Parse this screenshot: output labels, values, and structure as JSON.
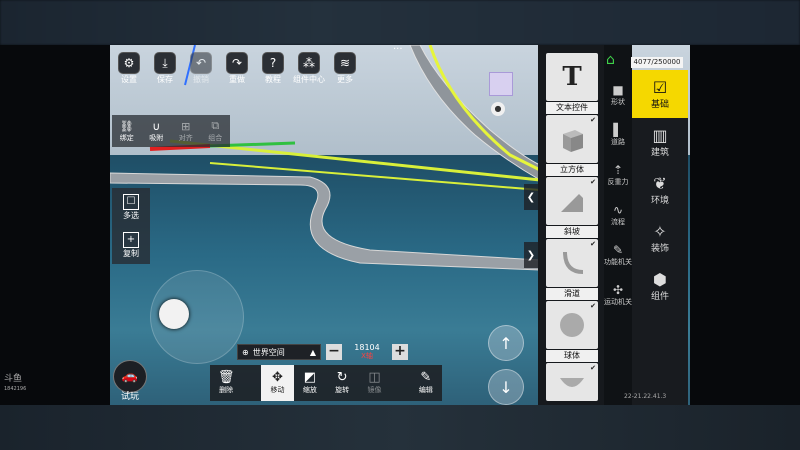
{
  "top_toolbar": [
    {
      "icon": "gear-icon",
      "label": "设置"
    },
    {
      "icon": "download-icon",
      "label": "保存"
    },
    {
      "icon": "undo-icon",
      "label": "撤销"
    },
    {
      "icon": "redo-icon",
      "label": "重做"
    },
    {
      "icon": "help-icon",
      "label": "教程"
    },
    {
      "icon": "components-icon",
      "label": "组件中心"
    },
    {
      "icon": "layers-icon",
      "label": "更多"
    }
  ],
  "snap_bar": [
    {
      "icon": "link-icon",
      "label": "绑定"
    },
    {
      "icon": "magnet-icon",
      "label": "吸附"
    },
    {
      "icon": "align-icon",
      "label": "对齐"
    },
    {
      "icon": "group-icon",
      "label": "组合"
    }
  ],
  "side_left": [
    {
      "icon": "multiselect-icon",
      "label": "多选"
    },
    {
      "icon": "copy-icon",
      "label": "复制"
    }
  ],
  "play_label": "试玩",
  "space_selector": {
    "label": "世界空间",
    "arrow": "▲"
  },
  "stepper": {
    "minus": "−",
    "value": "18104",
    "axis": "X轴",
    "plus": "+"
  },
  "bottom_bar": [
    {
      "icon": "trash-icon",
      "label": "删除",
      "state": "normal"
    },
    {
      "icon": "move-icon",
      "label": "移动",
      "state": "active"
    },
    {
      "icon": "scale-icon",
      "label": "缩放",
      "state": "normal"
    },
    {
      "icon": "rotate-icon",
      "label": "旋转",
      "state": "normal"
    },
    {
      "icon": "mirror-icon",
      "label": "镜像",
      "state": "dim"
    },
    {
      "icon": "edit-icon",
      "label": "编辑",
      "state": "normal"
    }
  ],
  "palette": [
    {
      "icon": "T",
      "label": "文本控件"
    },
    {
      "icon": "cube",
      "label": "立方体"
    },
    {
      "icon": "slope",
      "label": "斜坡"
    },
    {
      "icon": "slide",
      "label": "滑道"
    },
    {
      "icon": "sphere",
      "label": "球体"
    }
  ],
  "categories": [
    {
      "icon": "■",
      "label": "形状"
    },
    {
      "icon": "▌",
      "label": "道路"
    },
    {
      "icon": "⇡",
      "label": "反重力"
    },
    {
      "icon": "∿",
      "label": "流程"
    },
    {
      "icon": "🔧",
      "label": "功能机关"
    },
    {
      "icon": "✣",
      "label": "运动机关"
    }
  ],
  "right_column": [
    {
      "icon": "base-icon",
      "label": "基础",
      "active": true
    },
    {
      "icon": "building-icon",
      "label": "建筑",
      "active": false
    },
    {
      "icon": "leaf-icon",
      "label": "环境",
      "active": false
    },
    {
      "icon": "decoration-icon",
      "label": "装饰",
      "active": false
    },
    {
      "icon": "component-icon",
      "label": "组件",
      "active": false
    }
  ],
  "counter": "4077/250000",
  "coordinates": "22-21.22.41.3",
  "watermark": {
    "brand": "斗鱼",
    "id": "1842196"
  },
  "colors": {
    "accent": "#f5d800",
    "home": "#3fd04a",
    "axis": "#ff4040"
  }
}
